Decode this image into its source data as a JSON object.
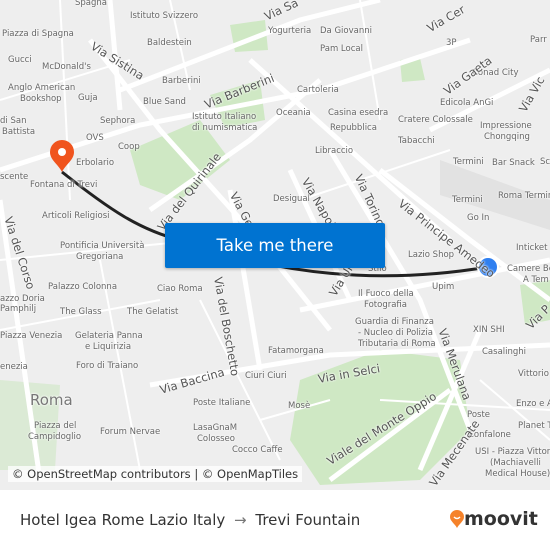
{
  "map": {
    "labels": [
      "Spagna",
      "Istituto Svizzero",
      "Piazza di Spagna",
      "Baldestein",
      "Gucci",
      "McDonald's",
      "Barberini",
      "Anglo American",
      "Bookshop",
      "Guja",
      "Blue Sand",
      "Sephora",
      "Istituto Italiano",
      "di numismatica",
      "di San",
      "Battista",
      "OVS",
      "Coop",
      "Erbolario",
      "Fontana di Trevi",
      "scente",
      "Articoli Religiosi",
      "Pontificia Università",
      "Gregoriana",
      "Palazzo Colonna",
      "Ciao Roma",
      "The Glass",
      "The Gelatist",
      "azzo Doria",
      "Pamphilj",
      "Piazza Venezia",
      "Gelateria Panna",
      "e Liquirizia",
      "enezia",
      "Foro di Traiano",
      "Piazza del",
      "Campidoglio",
      "Forum Nervae",
      "Poste Italiane",
      "LasaGnaM",
      "Colosseo",
      "Cocco Caffe",
      "Ciuri Ciuri",
      "Mosè",
      "Fatamorgana",
      "Guardia di Finanza",
      "- Nucleo di Polizia",
      "Tributaria di Roma",
      "Il Fuoco della",
      "Fotografia",
      "Upim",
      "Stilo",
      "Lazio Shop",
      "Go In",
      "Inticket",
      "Camere Be",
      "A Tem",
      "XIN SHI",
      "Casalinghi",
      "Vittorio",
      "Poste",
      "Enzo e A",
      "Confalone",
      "Planet T",
      "USI - Piazza Vittorio",
      "(Machiavelli",
      "Medical House)",
      "Desigual",
      "Libraccio",
      "Oceania",
      "Casina esedra",
      "Repubblica",
      "Cratere Colossale",
      "Tabacchi",
      "Termini",
      "Termini",
      "Bar Snack",
      "Roma Termini",
      "Impressione",
      "Chongqing",
      "Edicola AnGi",
      "Conad City",
      "3P",
      "Yogurteria",
      "Da Giovanni",
      "Pam Local",
      "Cartoleria",
      "Parr",
      "Sc"
    ],
    "streets": [
      "Via Sistina",
      "Via Barberini",
      "Via del Quirinale",
      "Via del Corso",
      "Via Gen",
      "Via del Boschetto",
      "Via Baccina",
      "Via in Selci",
      "Viale del Monte Oppio",
      "Via Mecenate",
      "Via Merulana",
      "Via Principe Amedeo",
      "Via Napoli",
      "Via Torino",
      "Via Gaeta",
      "Via Cer",
      "Via Vic",
      "Via Sa",
      "Via Ur",
      "Via P"
    ],
    "city": "Roma",
    "attribution": "© OpenStreetMap contributors | © OpenMapTiles",
    "route_color": "#222222",
    "origin_color": "#2f7ff0",
    "destination_color": "#f0541e"
  },
  "cta": {
    "label": "Take me there"
  },
  "footer": {
    "origin": "Hotel Igea Rome Lazio Italy",
    "destination": "Trevi Fountain",
    "arrow": "→",
    "logo": "moovit"
  }
}
